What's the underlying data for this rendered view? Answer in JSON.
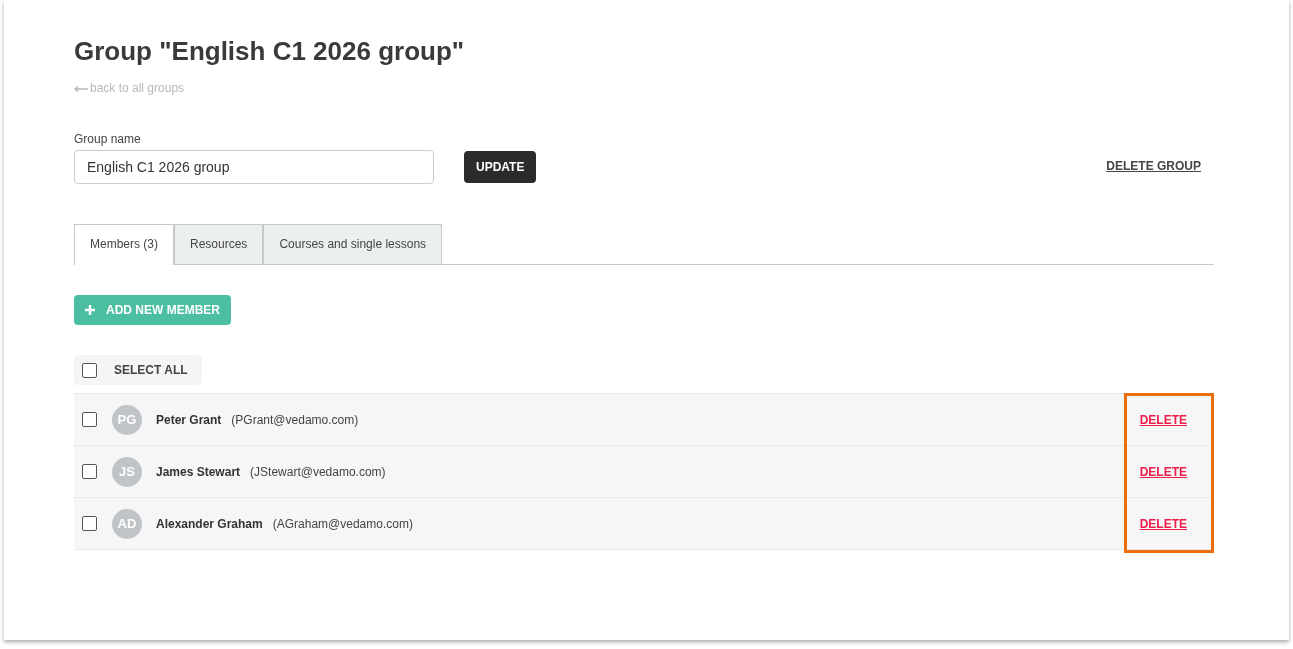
{
  "title": "Group \"English C1 2026 group\"",
  "back_link": "back to all groups",
  "group_name_field": {
    "label": "Group name",
    "value": "English C1 2026 group"
  },
  "update_button": "UPDATE",
  "delete_group_link": "DELETE GROUP",
  "tabs": [
    {
      "label": "Members (3)",
      "selected": true
    },
    {
      "label": "Resources",
      "selected": false
    },
    {
      "label": "Courses and single lessons",
      "selected": false
    }
  ],
  "add_member_button": "ADD NEW MEMBER",
  "select_all": {
    "label": "SELECT ALL",
    "checked": false
  },
  "members": [
    {
      "initials": "PG",
      "name": "Peter Grant",
      "email": "(PGrant@vedamo.com)",
      "checked": false,
      "action": "DELETE"
    },
    {
      "initials": "JS",
      "name": "James Stewart",
      "email": "(JStewart@vedamo.com)",
      "checked": false,
      "action": "DELETE"
    },
    {
      "initials": "AD",
      "name": "Alexander Graham",
      "email": "(AGraham@vedamo.com)",
      "checked": false,
      "action": "DELETE"
    }
  ]
}
